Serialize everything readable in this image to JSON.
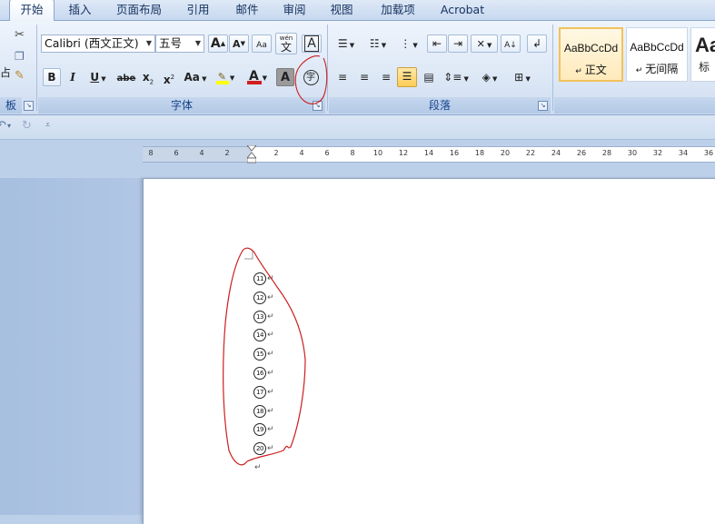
{
  "menu": {
    "tabs": [
      {
        "label": "开始",
        "active": true
      },
      {
        "label": "插入"
      },
      {
        "label": "页面布局"
      },
      {
        "label": "引用"
      },
      {
        "label": "邮件"
      },
      {
        "label": "审阅"
      },
      {
        "label": "视图"
      },
      {
        "label": "加载项"
      },
      {
        "label": "Acrobat"
      }
    ]
  },
  "ribbon": {
    "clipboard": {
      "label": "板",
      "paste_stub": "占"
    },
    "font": {
      "label": "字体",
      "font_name": "Calibri (西文正文)",
      "font_size": "五号",
      "grow_font": "A",
      "shrink_font": "A",
      "clear_format": "Aa",
      "phonetic": "wén",
      "phonetic_char": "文",
      "char_border": "A",
      "bold": "B",
      "italic": "I",
      "underline": "U",
      "strikethrough": "abe",
      "subscript": "x",
      "superscript": "x",
      "change_case": "Aa",
      "font_color": "A",
      "char_shading": "A",
      "enclose_char": "字"
    },
    "paragraph": {
      "label": "段落"
    },
    "styles": {
      "items": [
        {
          "sample": "AaBbCcDd",
          "name": "正文",
          "selected": true
        },
        {
          "sample": "AaBbCcDd",
          "name": "无间隔"
        },
        {
          "sample": "Aa",
          "name": "标"
        }
      ]
    }
  },
  "ruler": {
    "ticks": [
      "8",
      "6",
      "4",
      "2",
      "2",
      "4",
      "6",
      "8",
      "10",
      "12",
      "14",
      "16",
      "18",
      "20",
      "22",
      "24",
      "26",
      "28",
      "30",
      "32",
      "34",
      "36"
    ]
  },
  "document": {
    "paragraphs": [
      {
        "num": "11",
        "mark": "↵"
      },
      {
        "num": "12",
        "mark": "↵"
      },
      {
        "num": "13",
        "mark": "↵"
      },
      {
        "num": "14",
        "mark": "↵"
      },
      {
        "num": "15",
        "mark": "↵"
      },
      {
        "num": "16",
        "mark": "↵"
      },
      {
        "num": "17",
        "mark": "↵"
      },
      {
        "num": "18",
        "mark": "↵"
      },
      {
        "num": "19",
        "mark": "↵"
      },
      {
        "num": "20",
        "mark": "↵"
      }
    ],
    "last_mark": "↵"
  },
  "colors": {
    "highlight": "#ffff00",
    "font_color": "#d21e1e",
    "annotation": "#cc1f1f"
  }
}
